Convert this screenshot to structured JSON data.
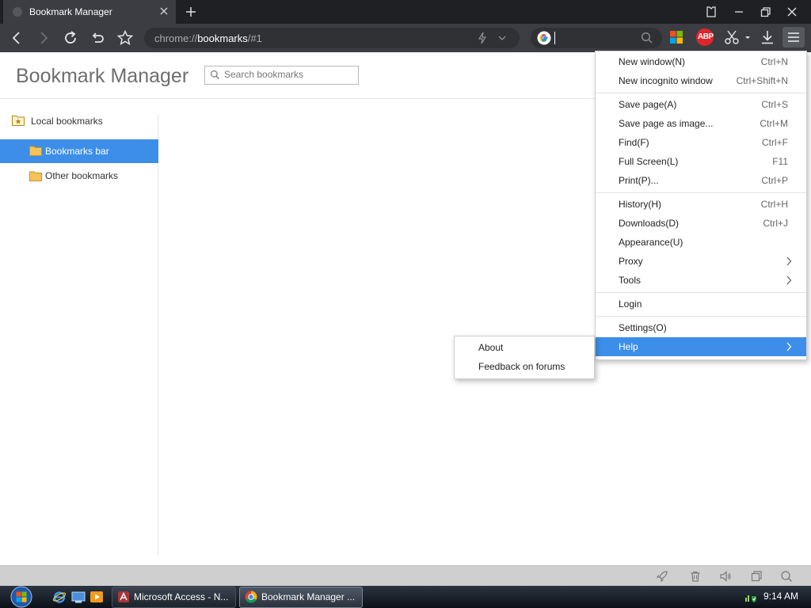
{
  "window": {
    "tab_title": "Bookmark Manager"
  },
  "toolbar": {
    "url_prefix": "chrome://",
    "url_host": "bookmarks",
    "url_suffix": "/#1",
    "abp_label": "ABP"
  },
  "page": {
    "title": "Bookmark Manager",
    "search_placeholder": "Search bookmarks"
  },
  "sidebar": {
    "root": "Local bookmarks",
    "items": [
      {
        "label": "Bookmarks bar",
        "selected": true
      },
      {
        "label": "Other bookmarks",
        "selected": false
      }
    ]
  },
  "menu": {
    "items": [
      {
        "label": "New window(N)",
        "shortcut": "Ctrl+N"
      },
      {
        "label": "New incognito window",
        "shortcut": "Ctrl+Shift+N"
      },
      {
        "label": "Save page(A)",
        "shortcut": "Ctrl+S"
      },
      {
        "label": "Save page as image...",
        "shortcut": "Ctrl+M"
      },
      {
        "label": "Find(F)",
        "shortcut": "Ctrl+F"
      },
      {
        "label": "Full Screen(L)",
        "shortcut": "F11"
      },
      {
        "label": "Print(P)...",
        "shortcut": "Ctrl+P"
      },
      {
        "label": "History(H)",
        "shortcut": "Ctrl+H"
      },
      {
        "label": "Downloads(D)",
        "shortcut": "Ctrl+J"
      },
      {
        "label": "Appearance(U)",
        "shortcut": ""
      },
      {
        "label": "Proxy",
        "shortcut": ""
      },
      {
        "label": "Tools",
        "shortcut": ""
      },
      {
        "label": "Login",
        "shortcut": ""
      },
      {
        "label": "Settings(O)",
        "shortcut": ""
      },
      {
        "label": "Help",
        "shortcut": "",
        "highlighted": true
      }
    ]
  },
  "help_submenu": {
    "items": [
      {
        "label": "About"
      },
      {
        "label": "Feedback on forums"
      }
    ]
  },
  "taskbar": {
    "tasks": [
      {
        "label": "Microsoft Access - N..."
      },
      {
        "label": "Bookmark Manager ..."
      }
    ],
    "clock": "9:14 AM"
  },
  "colors": {
    "accent": "#3d8ee8",
    "toolbar": "#3b3d42",
    "tabstrip": "#1e2024",
    "folder": "#f3c35a"
  }
}
